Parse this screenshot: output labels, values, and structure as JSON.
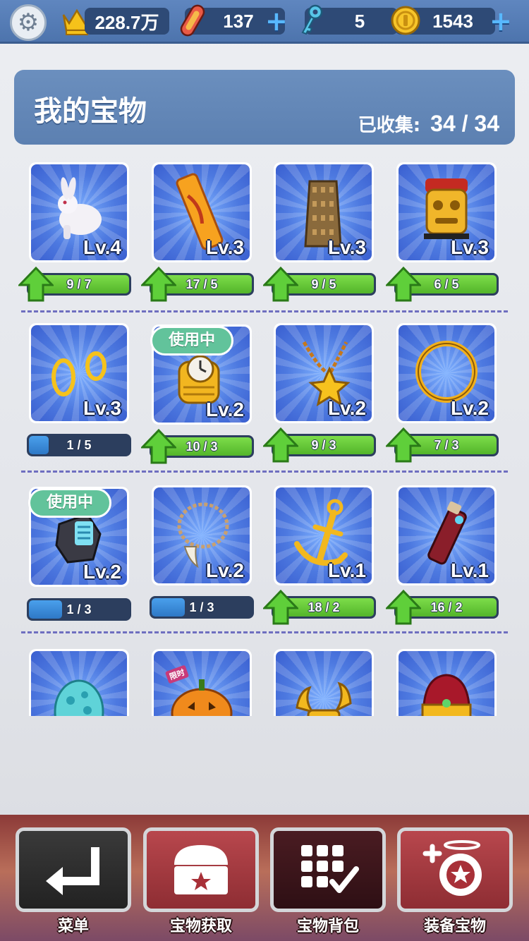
{
  "topbar": {
    "settings_icon": "gear-icon",
    "crown": {
      "icon": "crown-icon",
      "value": "228.7万"
    },
    "skateboard": {
      "icon": "skateboard-icon",
      "value": "137"
    },
    "keys": {
      "icon": "key-icon",
      "value": "5"
    },
    "coins": {
      "icon": "coin-icon",
      "value": "1543"
    },
    "plus_label": "+"
  },
  "header": {
    "title": "我的宝物",
    "collected_label": "已收集:",
    "collected_value": "34 / 34"
  },
  "in_use_label": "使用中",
  "treasures": [
    {
      "icon": "rabbit-icon",
      "level": "Lv.4",
      "progress": "9 / 7",
      "fill": 1.0,
      "bar": "green",
      "upgrade": true
    },
    {
      "icon": "surfboard-icon",
      "level": "Lv.3",
      "progress": "17 / 5",
      "fill": 1.0,
      "bar": "green",
      "upgrade": true
    },
    {
      "icon": "tower-icon",
      "level": "Lv.3",
      "progress": "9 / 5",
      "fill": 1.0,
      "bar": "green",
      "upgrade": true
    },
    {
      "icon": "mask-icon",
      "level": "Lv.3",
      "progress": "6 / 5",
      "fill": 1.0,
      "bar": "green",
      "upgrade": true
    },
    {
      "icon": "earrings-icon",
      "level": "Lv.3",
      "progress": "1 / 5",
      "fill": 0.2,
      "bar": "blue",
      "upgrade": false
    },
    {
      "icon": "watch-icon",
      "level": "Lv.2",
      "progress": "10 / 3",
      "fill": 1.0,
      "bar": "green",
      "upgrade": true,
      "in_use": true
    },
    {
      "icon": "star-necklace-icon",
      "level": "Lv.2",
      "progress": "9 / 3",
      "fill": 1.0,
      "bar": "green",
      "upgrade": true
    },
    {
      "icon": "ring-icon",
      "level": "Lv.2",
      "progress": "7 / 3",
      "fill": 1.0,
      "bar": "green",
      "upgrade": true
    },
    {
      "icon": "gadget-icon",
      "level": "Lv.2",
      "progress": "1 / 3",
      "fill": 0.33,
      "bar": "blue",
      "upgrade": false,
      "in_use": true
    },
    {
      "icon": "tooth-necklace-icon",
      "level": "Lv.2",
      "progress": "1 / 3",
      "fill": 0.33,
      "bar": "blue",
      "upgrade": false
    },
    {
      "icon": "anchor-icon",
      "level": "Lv.1",
      "progress": "18 / 2",
      "fill": 1.0,
      "bar": "green",
      "upgrade": true
    },
    {
      "icon": "spray-can-icon",
      "level": "Lv.1",
      "progress": "16 / 2",
      "fill": 1.0,
      "bar": "green",
      "upgrade": true
    },
    {
      "icon": "egg-icon"
    },
    {
      "icon": "pumpkin-icon",
      "badge": "限时"
    },
    {
      "icon": "horns-icon"
    },
    {
      "icon": "crown-icon"
    }
  ],
  "nav": [
    {
      "label": "菜单",
      "icon": "return-arrow-icon"
    },
    {
      "label": "宝物获取",
      "icon": "treasure-chest-icon"
    },
    {
      "label": "宝物背包",
      "icon": "grid-check-icon"
    },
    {
      "label": "装备宝物",
      "icon": "equip-treasure-icon"
    }
  ],
  "colors": {
    "topbar": "#5779b3",
    "header": "#6286b8",
    "bar_green": "#5ec234",
    "bar_blue": "#3a8cd8",
    "in_use_badge": "#62c39b",
    "divider": "#6f6fc0"
  }
}
